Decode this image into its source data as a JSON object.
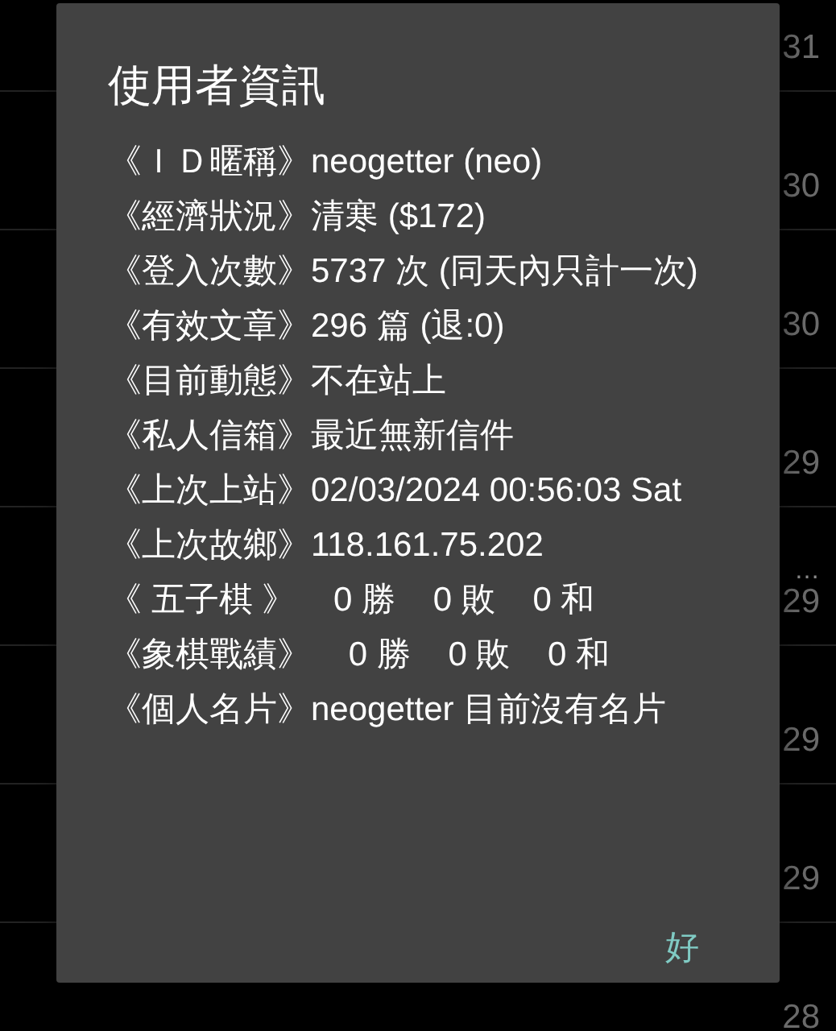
{
  "background_list": {
    "rows": [
      {
        "time": "31"
      },
      {
        "time": "30"
      },
      {
        "time": "30"
      },
      {
        "time": "29"
      },
      {
        "ellipsis": "…",
        "time": "29"
      },
      {
        "time": "29"
      },
      {
        "time": "29"
      },
      {
        "time": "28"
      }
    ]
  },
  "dialog": {
    "title": "使用者資訊",
    "lines": [
      {
        "label": "《ＩＤ暱稱》",
        "value": "neogetter (neo)"
      },
      {
        "label": "《經濟狀況》",
        "value": "清寒 ($172)"
      },
      {
        "label": "《登入次數》",
        "value": "5737 次 (同天內只計一次)"
      },
      {
        "label": "《有效文章》",
        "value": "296 篇 (退:0)"
      },
      {
        "label": "《目前動態》",
        "value": "不在站上"
      },
      {
        "label": "《私人信箱》",
        "value": "最近無新信件"
      },
      {
        "label": "《上次上站》",
        "value": "02/03/2024 00:56:03 Sat"
      },
      {
        "label": "《上次故鄉》",
        "value": "118.161.75.202"
      },
      {
        "label": "《 五子棋 》",
        "value": "    0 勝    0 敗    0 和"
      },
      {
        "label": "《象棋戰績》",
        "value": "    0 勝    0 敗    0 和"
      },
      {
        "label": "《個人名片》",
        "value": "neogetter 目前沒有名片"
      }
    ],
    "buttons": [
      "好"
    ]
  }
}
